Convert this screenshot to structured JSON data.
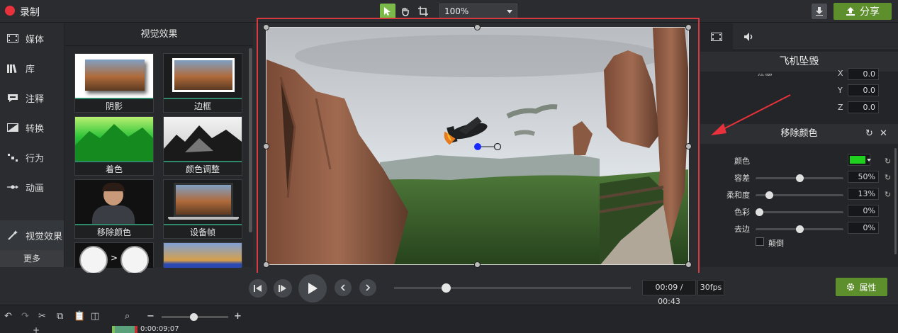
{
  "app": {
    "record_label": "录制",
    "zoom": "100%",
    "share_label": "分享",
    "accent": "#5d8f2d",
    "record_color": "#e8313a"
  },
  "nav": {
    "items": [
      {
        "label": "媒体",
        "icon": "film-strip-icon"
      },
      {
        "label": "库",
        "icon": "library-icon"
      },
      {
        "label": "注释",
        "icon": "annotation-icon"
      },
      {
        "label": "转换",
        "icon": "transition-icon"
      },
      {
        "label": "行为",
        "icon": "behavior-icon"
      },
      {
        "label": "动画",
        "icon": "animation-icon"
      },
      {
        "label": "视觉效果",
        "icon": "magic-wand-icon"
      }
    ],
    "more": "更多"
  },
  "effects": {
    "title": "视觉效果",
    "items": [
      {
        "label": "阴影"
      },
      {
        "label": "边框"
      },
      {
        "label": "着色"
      },
      {
        "label": "颜色调整"
      },
      {
        "label": "移除颜色"
      },
      {
        "label": "设备帧"
      }
    ]
  },
  "properties": {
    "clip_title": "飞机坠毁",
    "position_label": "位置",
    "coords": [
      {
        "axis": "X",
        "value": "0.0"
      },
      {
        "axis": "Y",
        "value": "0.0"
      },
      {
        "axis": "Z",
        "value": "0.0"
      }
    ],
    "effect_title": "移除颜色",
    "color_label": "颜色",
    "color_value": "#1fd01f",
    "sliders": [
      {
        "label": "容差",
        "value": "50%",
        "fraction": 0.5,
        "reset": true
      },
      {
        "label": "柔和度",
        "value": "13%",
        "fraction": 0.13,
        "reset": true
      },
      {
        "label": "色彩",
        "value": "0%",
        "fraction": 0.0,
        "reset": false
      },
      {
        "label": "去边",
        "value": "0%",
        "fraction": 0.5,
        "reset": false
      }
    ],
    "invert_label": "颠倒"
  },
  "playback": {
    "time": "00:09 / 00:43",
    "fps": "30fps",
    "progress": 0.22,
    "props_label": "属性"
  },
  "timeline": {
    "playhead_time": "0:00:09;07"
  }
}
